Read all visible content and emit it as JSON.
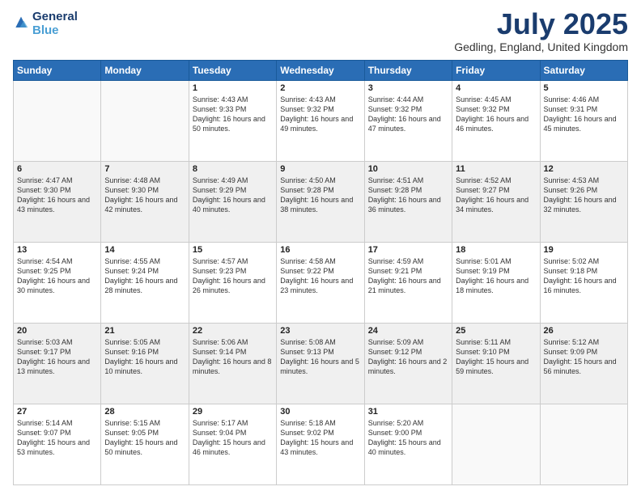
{
  "header": {
    "logo_line1": "General",
    "logo_line2": "Blue",
    "month": "July 2025",
    "location": "Gedling, England, United Kingdom"
  },
  "days_of_week": [
    "Sunday",
    "Monday",
    "Tuesday",
    "Wednesday",
    "Thursday",
    "Friday",
    "Saturday"
  ],
  "weeks": [
    [
      {
        "day": "",
        "info": ""
      },
      {
        "day": "",
        "info": ""
      },
      {
        "day": "1",
        "info": "Sunrise: 4:43 AM\nSunset: 9:33 PM\nDaylight: 16 hours and 50 minutes."
      },
      {
        "day": "2",
        "info": "Sunrise: 4:43 AM\nSunset: 9:32 PM\nDaylight: 16 hours and 49 minutes."
      },
      {
        "day": "3",
        "info": "Sunrise: 4:44 AM\nSunset: 9:32 PM\nDaylight: 16 hours and 47 minutes."
      },
      {
        "day": "4",
        "info": "Sunrise: 4:45 AM\nSunset: 9:32 PM\nDaylight: 16 hours and 46 minutes."
      },
      {
        "day": "5",
        "info": "Sunrise: 4:46 AM\nSunset: 9:31 PM\nDaylight: 16 hours and 45 minutes."
      }
    ],
    [
      {
        "day": "6",
        "info": "Sunrise: 4:47 AM\nSunset: 9:30 PM\nDaylight: 16 hours and 43 minutes."
      },
      {
        "day": "7",
        "info": "Sunrise: 4:48 AM\nSunset: 9:30 PM\nDaylight: 16 hours and 42 minutes."
      },
      {
        "day": "8",
        "info": "Sunrise: 4:49 AM\nSunset: 9:29 PM\nDaylight: 16 hours and 40 minutes."
      },
      {
        "day": "9",
        "info": "Sunrise: 4:50 AM\nSunset: 9:28 PM\nDaylight: 16 hours and 38 minutes."
      },
      {
        "day": "10",
        "info": "Sunrise: 4:51 AM\nSunset: 9:28 PM\nDaylight: 16 hours and 36 minutes."
      },
      {
        "day": "11",
        "info": "Sunrise: 4:52 AM\nSunset: 9:27 PM\nDaylight: 16 hours and 34 minutes."
      },
      {
        "day": "12",
        "info": "Sunrise: 4:53 AM\nSunset: 9:26 PM\nDaylight: 16 hours and 32 minutes."
      }
    ],
    [
      {
        "day": "13",
        "info": "Sunrise: 4:54 AM\nSunset: 9:25 PM\nDaylight: 16 hours and 30 minutes."
      },
      {
        "day": "14",
        "info": "Sunrise: 4:55 AM\nSunset: 9:24 PM\nDaylight: 16 hours and 28 minutes."
      },
      {
        "day": "15",
        "info": "Sunrise: 4:57 AM\nSunset: 9:23 PM\nDaylight: 16 hours and 26 minutes."
      },
      {
        "day": "16",
        "info": "Sunrise: 4:58 AM\nSunset: 9:22 PM\nDaylight: 16 hours and 23 minutes."
      },
      {
        "day": "17",
        "info": "Sunrise: 4:59 AM\nSunset: 9:21 PM\nDaylight: 16 hours and 21 minutes."
      },
      {
        "day": "18",
        "info": "Sunrise: 5:01 AM\nSunset: 9:19 PM\nDaylight: 16 hours and 18 minutes."
      },
      {
        "day": "19",
        "info": "Sunrise: 5:02 AM\nSunset: 9:18 PM\nDaylight: 16 hours and 16 minutes."
      }
    ],
    [
      {
        "day": "20",
        "info": "Sunrise: 5:03 AM\nSunset: 9:17 PM\nDaylight: 16 hours and 13 minutes."
      },
      {
        "day": "21",
        "info": "Sunrise: 5:05 AM\nSunset: 9:16 PM\nDaylight: 16 hours and 10 minutes."
      },
      {
        "day": "22",
        "info": "Sunrise: 5:06 AM\nSunset: 9:14 PM\nDaylight: 16 hours and 8 minutes."
      },
      {
        "day": "23",
        "info": "Sunrise: 5:08 AM\nSunset: 9:13 PM\nDaylight: 16 hours and 5 minutes."
      },
      {
        "day": "24",
        "info": "Sunrise: 5:09 AM\nSunset: 9:12 PM\nDaylight: 16 hours and 2 minutes."
      },
      {
        "day": "25",
        "info": "Sunrise: 5:11 AM\nSunset: 9:10 PM\nDaylight: 15 hours and 59 minutes."
      },
      {
        "day": "26",
        "info": "Sunrise: 5:12 AM\nSunset: 9:09 PM\nDaylight: 15 hours and 56 minutes."
      }
    ],
    [
      {
        "day": "27",
        "info": "Sunrise: 5:14 AM\nSunset: 9:07 PM\nDaylight: 15 hours and 53 minutes."
      },
      {
        "day": "28",
        "info": "Sunrise: 5:15 AM\nSunset: 9:05 PM\nDaylight: 15 hours and 50 minutes."
      },
      {
        "day": "29",
        "info": "Sunrise: 5:17 AM\nSunset: 9:04 PM\nDaylight: 15 hours and 46 minutes."
      },
      {
        "day": "30",
        "info": "Sunrise: 5:18 AM\nSunset: 9:02 PM\nDaylight: 15 hours and 43 minutes."
      },
      {
        "day": "31",
        "info": "Sunrise: 5:20 AM\nSunset: 9:00 PM\nDaylight: 15 hours and 40 minutes."
      },
      {
        "day": "",
        "info": ""
      },
      {
        "day": "",
        "info": ""
      }
    ]
  ]
}
